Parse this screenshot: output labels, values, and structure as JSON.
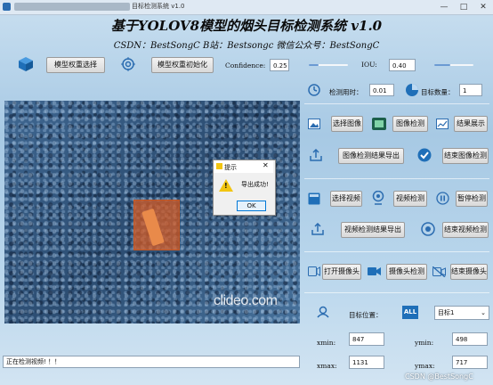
{
  "window": {
    "title": "目标检测系统 v1.0",
    "controls": {
      "minimize": "—",
      "maximize": "□",
      "close": "✕"
    }
  },
  "header": {
    "title": "基于YOLOV8模型的烟头目标检测系统 v1.0",
    "subtitle": "CSDN：BestSongC   B站：Bestsongc   微信公众号：BestSongC"
  },
  "toolbar": {
    "model_select": "模型权重选择",
    "model_init": "模型权重初始化",
    "confidence_label": "Confidence:",
    "confidence_value": "0.25",
    "confidence_level": 0.25,
    "iou_label": "IOU:",
    "iou_value": "0.40",
    "iou_level": 0.4
  },
  "stats": {
    "time_label": "检测用时：",
    "time_value": "0.01",
    "count_label": "目标数量：",
    "count_value": "1"
  },
  "image_panel": {
    "select": "选择图像",
    "detect": "图像检测",
    "show": "结果展示",
    "export": "图像检测结果导出",
    "stop": "结束图像检测"
  },
  "video_panel": {
    "select": "选择视频",
    "detect": "视频检测",
    "pause": "暂停检测",
    "export": "视频检测结果导出",
    "stop": "结束视频检测"
  },
  "camera_panel": {
    "open": "打开摄像头",
    "detect": "摄像头检测",
    "close": "结束摄像头"
  },
  "target": {
    "position_label": "目标位置：",
    "select_value": "目标1",
    "xmin_label": "xmin:",
    "xmin": "847",
    "ymin_label": "ymin:",
    "ymin": "498",
    "xmax_label": "xmax:",
    "xmax": "1131",
    "ymax_label": "ymax:",
    "ymax": "717"
  },
  "view": {
    "watermark": "clideo.com"
  },
  "dialog": {
    "title": "提示",
    "message": "导出成功!",
    "ok": "OK",
    "close": "✕"
  },
  "status": {
    "text": "正在检测视频! ！！"
  },
  "watermark": "CSDN @BestSongC",
  "colors": {
    "accent": "#2b6cb0",
    "detect_box": "#d65c26",
    "warning": "#f2c511"
  }
}
